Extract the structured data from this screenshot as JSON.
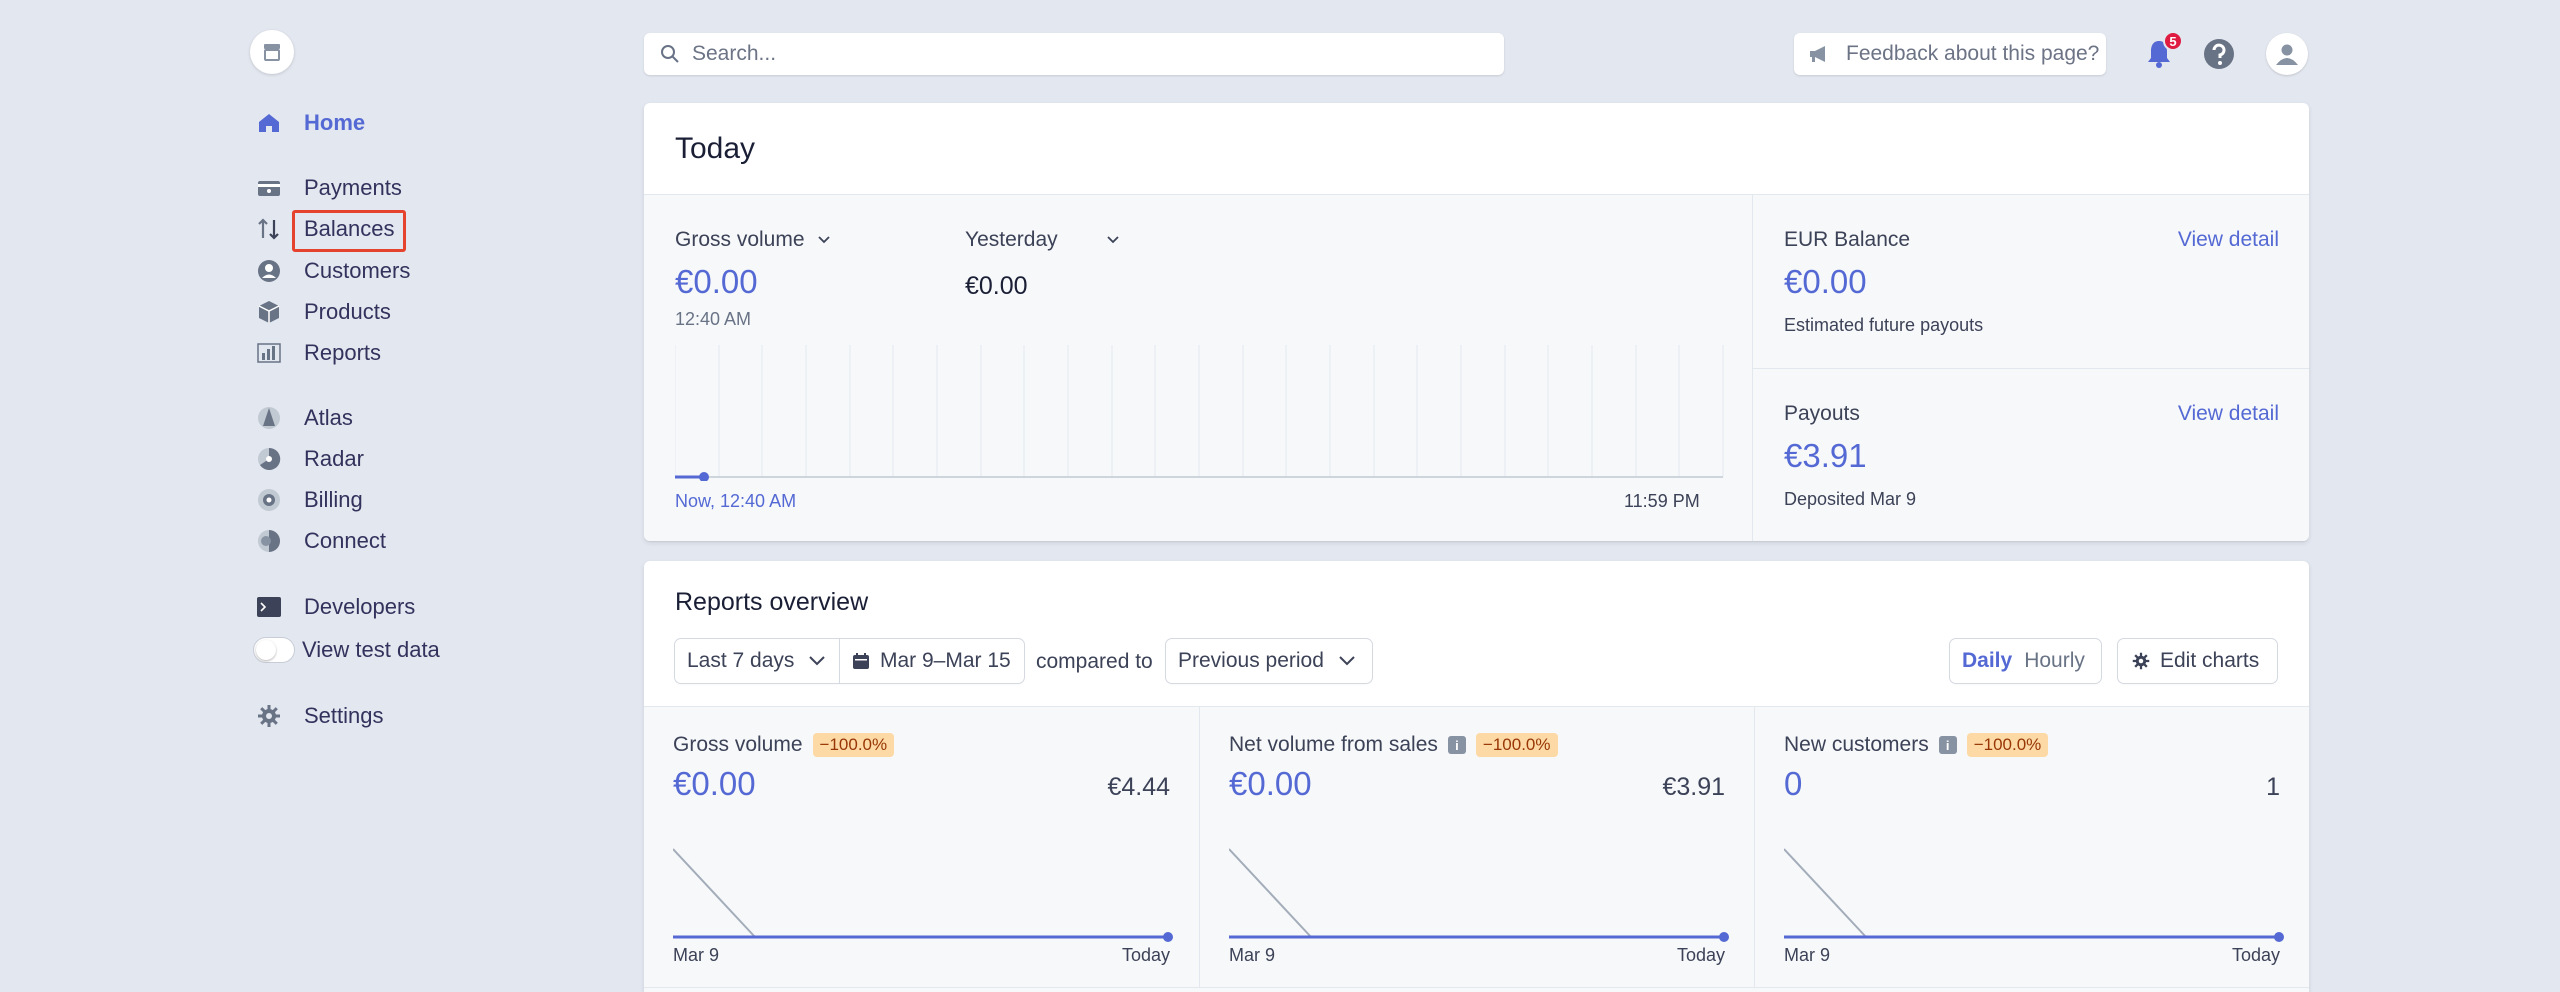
{
  "sidebar": {
    "home": "Home",
    "items": [
      {
        "label": "Payments",
        "icon": "payments-icon"
      },
      {
        "label": "Balances",
        "icon": "balances-icon"
      },
      {
        "label": "Customers",
        "icon": "customers-icon"
      },
      {
        "label": "Products",
        "icon": "products-icon"
      },
      {
        "label": "Reports",
        "icon": "reports-icon"
      }
    ],
    "items2": [
      {
        "label": "Atlas",
        "icon": "atlas-icon"
      },
      {
        "label": "Radar",
        "icon": "radar-icon"
      },
      {
        "label": "Billing",
        "icon": "billing-icon"
      },
      {
        "label": "Connect",
        "icon": "connect-icon"
      }
    ],
    "developers": "Developers",
    "test_data": "View test data",
    "settings": "Settings"
  },
  "topbar": {
    "search_placeholder": "Search...",
    "feedback": "Feedback about this page?",
    "notifications_count": "5"
  },
  "today": {
    "title": "Today",
    "gross_label": "Gross volume",
    "gross_value": "€0.00",
    "gross_time": "12:40 AM",
    "compare_label": "Yesterday",
    "compare_value": "€0.00",
    "axis_start": "Now, 12:40 AM",
    "axis_end": "11:59 PM",
    "balance_label": "EUR Balance",
    "balance_value": "€0.00",
    "balance_sub": "Estimated future payouts",
    "payouts_label": "Payouts",
    "payouts_value": "€3.91",
    "payouts_sub": "Deposited Mar 9",
    "view_detail": "View detail"
  },
  "reports": {
    "title": "Reports overview",
    "range": "Last 7 days",
    "dates": "Mar 9–Mar 15",
    "compared_to": "compared to",
    "previous": "Previous period",
    "daily": "Daily",
    "hourly": "Hourly",
    "edit_charts": "Edit charts",
    "metrics": [
      {
        "label": "Gross volume",
        "change": "−100.0%",
        "value": "€0.00",
        "previous": "€4.44",
        "start": "Mar 9",
        "end": "Today"
      },
      {
        "label": "Net volume from sales",
        "change": "−100.0%",
        "value": "€0.00",
        "previous": "€3.91",
        "start": "Mar 9",
        "end": "Today"
      },
      {
        "label": "New customers",
        "change": "−100.0%",
        "value": "0",
        "previous": "1",
        "start": "Mar 9",
        "end": "Today"
      }
    ]
  },
  "colors": {
    "accent": "#5469d4",
    "highlight": "#e5432d",
    "badge": "#df1b41"
  }
}
